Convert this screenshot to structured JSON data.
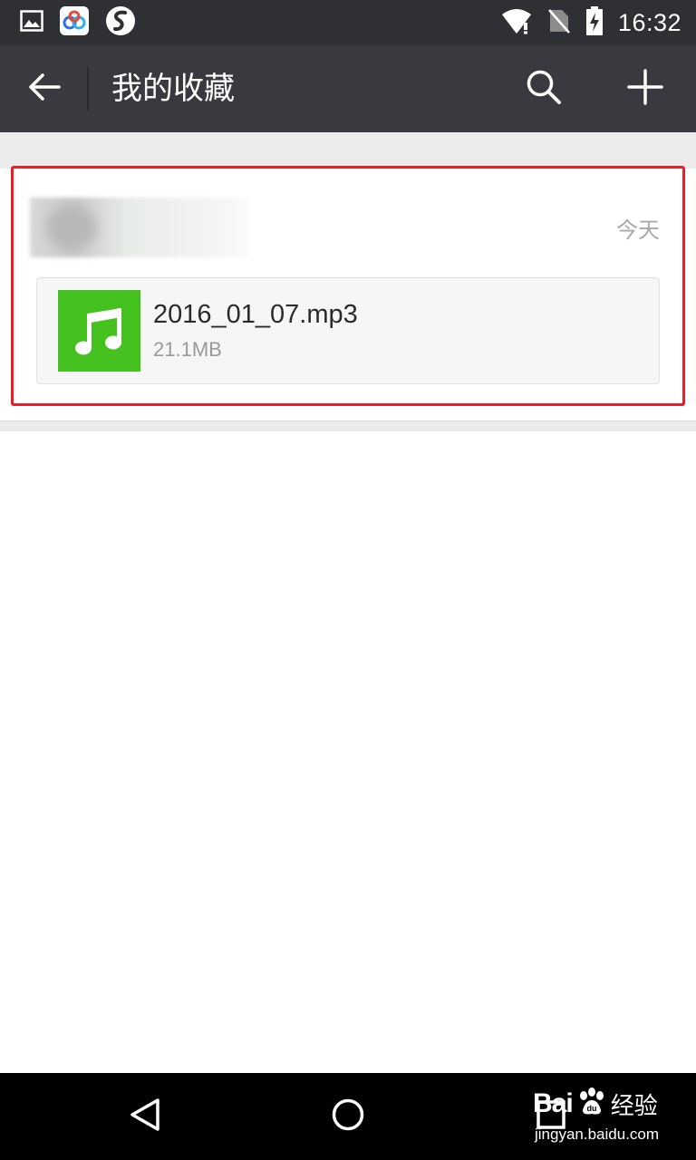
{
  "status_bar": {
    "time": "16:32",
    "left_icons": [
      "gallery-icon",
      "baidu-cloud-icon",
      "s-app-icon"
    ],
    "right_icons": [
      "wifi-icon",
      "no-sim-icon",
      "battery-charging-icon"
    ]
  },
  "action_bar": {
    "title": "我的收藏",
    "back_icon": "arrow-left-icon",
    "search_icon": "search-icon",
    "add_icon": "plus-icon"
  },
  "favorite_item": {
    "date": "今天",
    "file": {
      "name": "2016_01_07.mp3",
      "size": "21.1MB",
      "icon": "music-note-icon",
      "icon_color": "#44c11e"
    }
  },
  "nav_bar": {
    "icons": [
      "nav-back-icon",
      "nav-home-icon",
      "nav-recents-icon"
    ]
  },
  "watermark": {
    "brand_latin": "Bai",
    "brand_cn": "经验",
    "url": "jingyan.baidu.com"
  },
  "colors": {
    "status_bar": "#2f3033",
    "action_bar": "#393a3f",
    "annotation": "#ee1c24",
    "music_green": "#44c11e"
  }
}
